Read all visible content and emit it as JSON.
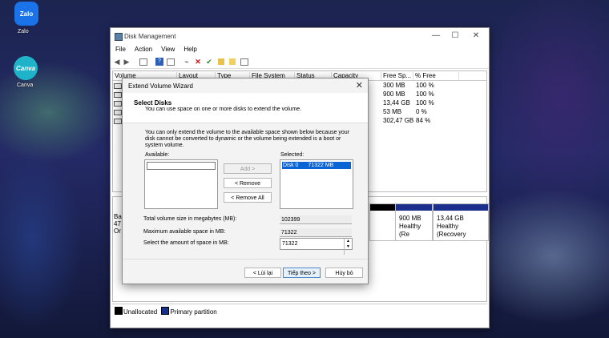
{
  "desktop": {
    "icons": [
      {
        "label": "Zalo",
        "tile_text": "Zalo",
        "color": "#1a73e8"
      },
      {
        "label": "Canva",
        "tile_text": "Canva",
        "color": "#1fb3c9"
      }
    ]
  },
  "window": {
    "title": "Disk Management",
    "controls": {
      "minimize": "—",
      "maximize": "☐",
      "close": "✕"
    },
    "menu": [
      "File",
      "Action",
      "View",
      "Help"
    ],
    "toolbar_icons": [
      "back-icon",
      "forward-icon",
      "list-icon",
      "help-icon",
      "properties-icon",
      "connect-icon",
      "delete-icon",
      "check-icon",
      "folder-icon",
      "folder-open-icon",
      "panel-icon"
    ],
    "table": {
      "columns": [
        "Volume",
        "Layout",
        "Type",
        "File System",
        "Status",
        "Capacity",
        "Free Sp...",
        "% Free"
      ],
      "rows": [
        {
          "free": "300 MB",
          "pct": "100 %"
        },
        {
          "free": "900 MB",
          "pct": "100 %"
        },
        {
          "free": "13,44 GB",
          "pct": "100 %"
        },
        {
          "free": "53 MB",
          "pct": "0 %"
        },
        {
          "free": "302,47 GB",
          "pct": "84 %"
        }
      ]
    },
    "graph": {
      "disk_label_lines": [
        "Ba",
        "47",
        "Or"
      ],
      "partitions": [
        {
          "line1": "900 MB",
          "line2": "Healthy (Re"
        },
        {
          "line1": "13,44 GB",
          "line2": "Healthy (Recovery"
        }
      ]
    },
    "legend": [
      {
        "label": "Unallocated",
        "color": "#000000"
      },
      {
        "label": "Primary partition",
        "color": "#1a2e8c"
      }
    ]
  },
  "dialog": {
    "title": "Extend Volume Wizard",
    "close": "✕",
    "heading": "Select Disks",
    "subheading": "You can use space on one or more disks to extend the volume.",
    "info": "You can only extend the volume to the available space shown below because your disk cannot be converted to dynamic or the volume being extended is a boot or system volume.",
    "available_label": "Available:",
    "selected_label": "Selected:",
    "selected_items": [
      {
        "disk": "Disk 0",
        "size": "71322 MB"
      }
    ],
    "add_button": "Add >",
    "remove_button": "< Remove",
    "remove_all_button": "< Remove All",
    "total_label": "Total volume size in megabytes (MB):",
    "total_value": "102399",
    "max_label": "Maximum available space in MB:",
    "max_value": "71322",
    "amount_label": "Select the amount of space in MB:",
    "amount_value": "71322",
    "back_button": "< Lùi lại",
    "next_button": "Tiếp theo >",
    "cancel_button": "Hủy bỏ"
  }
}
